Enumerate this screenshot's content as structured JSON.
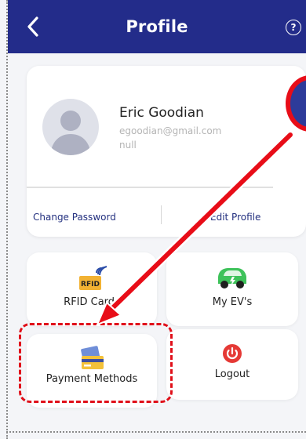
{
  "header": {
    "title": "Profile",
    "back_icon": "chevron-left-icon",
    "help_icon": "question-circle-icon",
    "help_glyph": "?"
  },
  "profile": {
    "name": "Eric Goodian",
    "email": "egoodian@gmail.com",
    "extra": "null",
    "change_password_label": "Change Password",
    "edit_profile_label": "Edit Profile"
  },
  "tiles": {
    "rfid": {
      "label": "RFID Cards",
      "badge": "RFID",
      "icon": "rfid-card-icon"
    },
    "ev": {
      "label": "My EV's",
      "icon": "electric-car-icon"
    },
    "payment": {
      "label": "Payment Methods",
      "icon": "credit-card-icon"
    },
    "logout": {
      "label": "Logout",
      "icon": "power-icon"
    }
  },
  "colors": {
    "header_bg": "#232c8a",
    "link": "#23307f",
    "annotation_red": "#e0101a",
    "ev_green": "#3ec25a",
    "logout_red": "#e53935"
  }
}
